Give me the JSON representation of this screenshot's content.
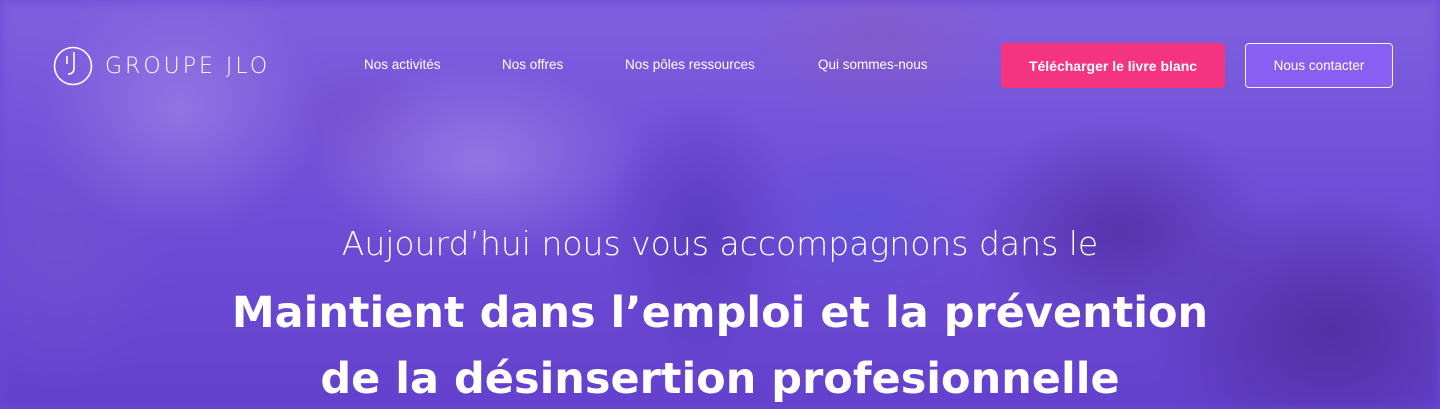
{
  "brand": {
    "name": "GROUPE JLO",
    "logo_icon": "jlo-circle-logo-icon"
  },
  "nav": {
    "items": [
      {
        "label": "Nos activités"
      },
      {
        "label": "Nos offres"
      },
      {
        "label": "Nos pôles ressources"
      },
      {
        "label": "Qui sommes-nous"
      }
    ],
    "cta_download": "Télécharger le livre blanc",
    "cta_contact": "Nous contacter"
  },
  "hero": {
    "subtitle": "Aujourd’hui nous vous accompagnons dans le",
    "headline_line1": "Maintient dans l’emploi et la prévention",
    "headline_line2": "de la désinsertion profesionnelle"
  },
  "colors": {
    "overlay": "#6a4bd0",
    "download_button": "#f5347f",
    "contact_button": "#8a5ef0",
    "text": "#ffffff"
  }
}
